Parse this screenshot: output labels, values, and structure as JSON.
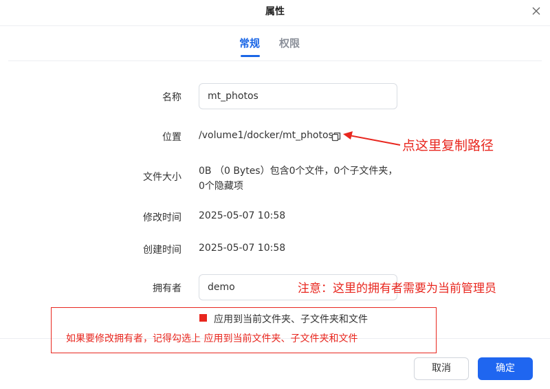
{
  "dialog": {
    "title": "属性"
  },
  "tabs": [
    {
      "label": "常规",
      "active": true
    },
    {
      "label": "权限",
      "active": false
    }
  ],
  "fields": {
    "name": {
      "label": "名称",
      "value": "mt_photos"
    },
    "location": {
      "label": "位置",
      "value": "/volume1/docker/mt_photos"
    },
    "size": {
      "label": "文件大小",
      "line1": "0B （0 Bytes）包含0个文件，0个子文件夹，",
      "line2": "0个隐藏项"
    },
    "modified": {
      "label": "修改时间",
      "value": "2025-05-07 10:58"
    },
    "created": {
      "label": "创建时间",
      "value": "2025-05-07 10:58"
    },
    "owner": {
      "label": "拥有者",
      "value": "demo"
    }
  },
  "apply_checkbox": {
    "label": "应用到当前文件夹、子文件夹和文件"
  },
  "footer": {
    "cancel_label": "取消",
    "ok_label": "确定"
  },
  "annotations": {
    "copy_path": "点这里复制路径",
    "owner_note": "注意：这里的拥有者需要为当前管理员",
    "apply_note": "如果要修改拥有者，记得勾选上 应用到当前文件夹、子文件夹和文件"
  },
  "colors": {
    "accent": "#1f66f0",
    "annotation": "#e8261e"
  },
  "icons": {
    "close": "close-icon",
    "copy": "copy-icon"
  }
}
